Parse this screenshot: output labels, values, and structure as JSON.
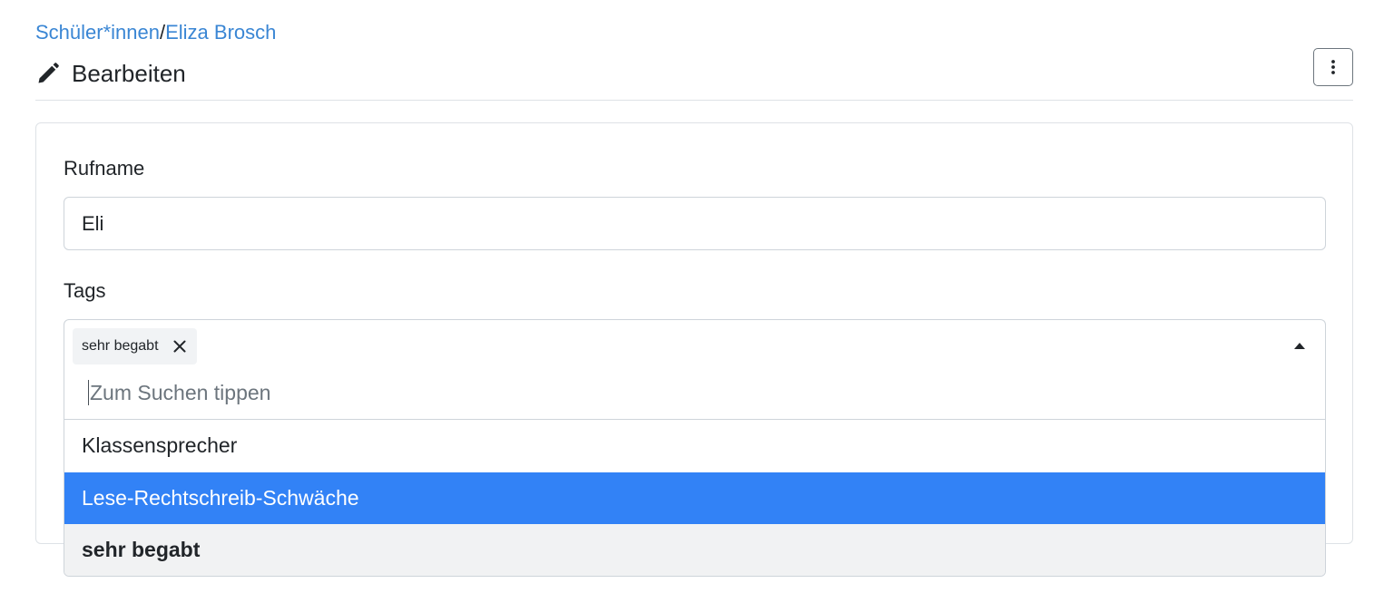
{
  "breadcrumb": {
    "parent": "Schüler*innen",
    "separator": "/",
    "current": "Eliza Brosch"
  },
  "header": {
    "title": "Bearbeiten",
    "title_icon": "pencil-icon",
    "menu_icon": "kebab-icon"
  },
  "form": {
    "rufname_label": "Rufname",
    "rufname_value": "Eli",
    "tags_label": "Tags",
    "selected_tags": [
      "sehr begabt"
    ],
    "search_placeholder": "Zum Suchen tippen",
    "options": [
      {
        "label": "Klassensprecher"
      },
      {
        "label": "Lese-Rechtschreib-Schwäche"
      },
      {
        "label": "sehr begabt"
      }
    ]
  },
  "colors": {
    "link": "#3a86d4",
    "highlight": "#3282f6"
  }
}
